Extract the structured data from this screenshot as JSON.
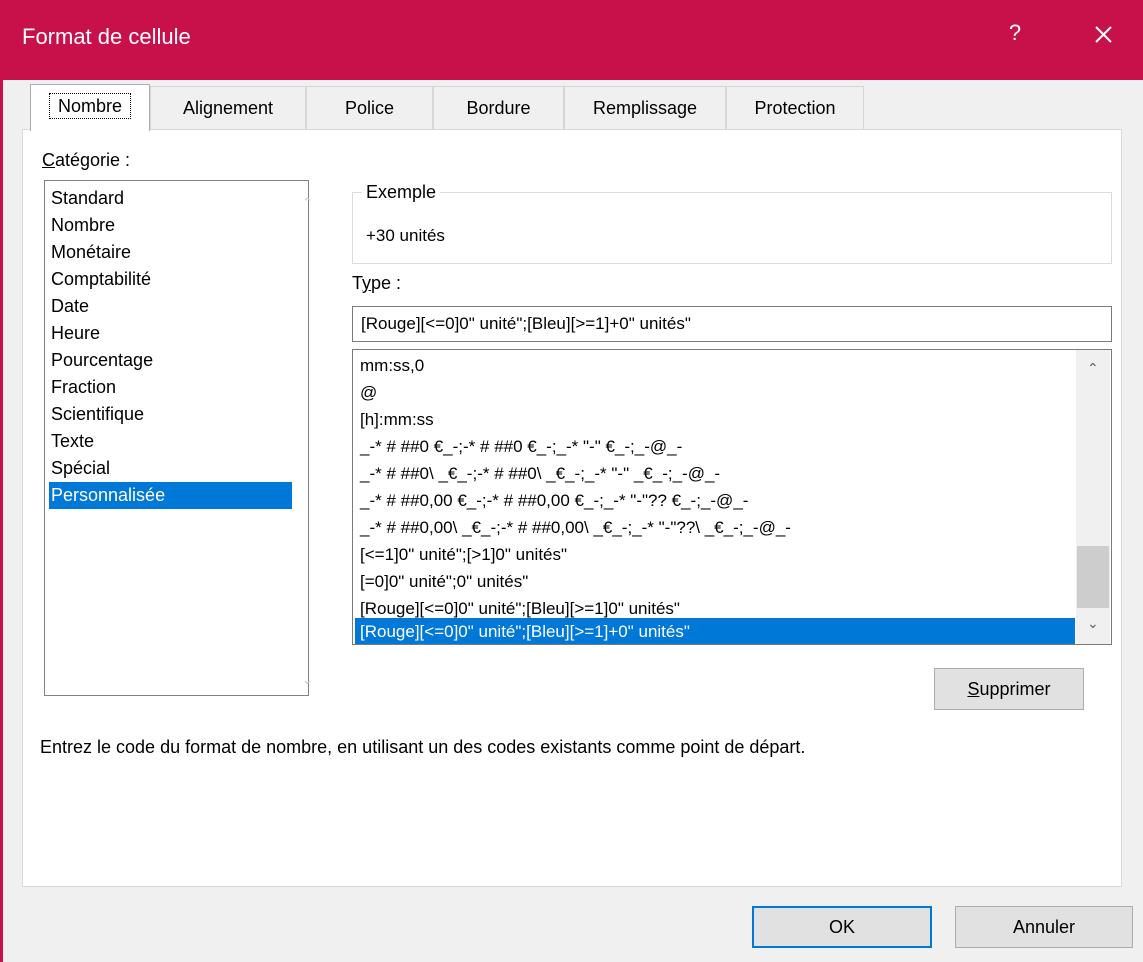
{
  "window": {
    "title": "Format de cellule",
    "help_label": "?"
  },
  "tabs": [
    {
      "label": "Nombre",
      "active": true
    },
    {
      "label": "Alignement"
    },
    {
      "label": "Police"
    },
    {
      "label": "Bordure"
    },
    {
      "label": "Remplissage"
    },
    {
      "label": "Protection"
    }
  ],
  "category": {
    "label_prefix": "C",
    "label_rest": "atégorie :",
    "items": [
      "Standard",
      "Nombre",
      "Monétaire",
      "Comptabilité",
      "Date",
      "Heure",
      "Pourcentage",
      "Fraction",
      "Scientifique",
      "Texte",
      "Spécial",
      "Personnalisée"
    ],
    "selected": "Personnalisée"
  },
  "example": {
    "legend": "Exemple",
    "value": "+30 unités"
  },
  "type": {
    "label_prefix": "T",
    "label_underlined": "y",
    "label_rest": "pe :",
    "value": "[Rouge][<=0]0\" unité\";[Bleu][>=1]+0\" unités\"",
    "list": [
      "mm:ss,0",
      "@",
      "[h]:mm:ss",
      "_-* # ##0 €_-;-* # ##0 €_-;_-* \"-\" €_-;_-@_-",
      "_-* # ##0\\ _€_-;-* # ##0\\ _€_-;_-* \"-\" _€_-;_-@_-",
      "_-* # ##0,00 €_-;-* # ##0,00 €_-;_-* \"-\"?? €_-;_-@_-",
      "_-* # ##0,00\\ _€_-;-* # ##0,00\\ _€_-;_-* \"-\"??\\ _€_-;_-@_-",
      "[<=1]0\" unité\";[>1]0\" unités\"",
      "[=0]0\" unité\";0\" unités\"",
      "[Rouge][<=0]0\" unité\";[Bleu][>=1]0\" unités\"",
      "[Rouge][<=0]0\" unité\";[Bleu][>=1]+0\" unités\""
    ],
    "selected_index": 10
  },
  "buttons": {
    "delete_prefix": "S",
    "delete_rest": "upprimer",
    "ok": "OK",
    "cancel": "Annuler"
  },
  "hint": "Entrez le code du format de nombre, en utilisant un des codes existants comme point de départ."
}
